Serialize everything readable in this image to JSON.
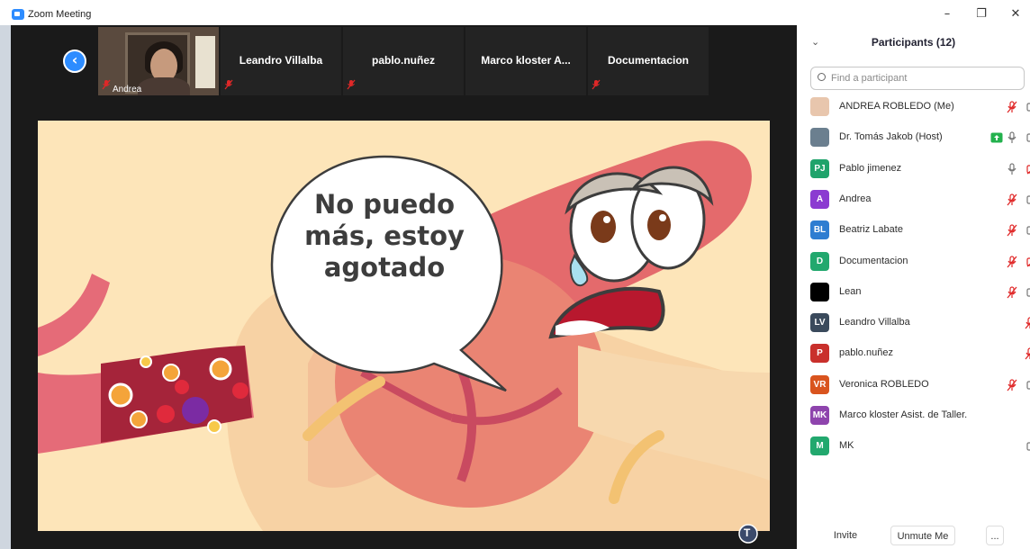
{
  "window": {
    "title": "Zoom Meeting",
    "controls": [
      "–",
      "❐",
      "✕"
    ]
  },
  "video_strip": {
    "self_view_label": "Andrea",
    "tiles": [
      {
        "name": "Leandro Villalba"
      },
      {
        "name": "pablo.nuñez"
      },
      {
        "name": "Marco kloster A..."
      },
      {
        "name": "Documentacion"
      }
    ]
  },
  "shared_screen": {
    "speech_line1": "No puedo",
    "speech_line2": "más, estoy",
    "speech_line3": "agotado",
    "badge": "T"
  },
  "participants_panel": {
    "title": "Participants (12)",
    "search_placeholder": "Find a participant",
    "participants": [
      {
        "initials": "",
        "name": "ANDREA ROBLEDO (Me)",
        "avatar_color": "#e8c6ad",
        "photo": true,
        "mic": "muted",
        "video": "on"
      },
      {
        "initials": "",
        "name": "Dr. Tomás Jakob (Host)",
        "avatar_color": "#6b7f8f",
        "photo": true,
        "mic": "on",
        "video": "on",
        "screen_share": true
      },
      {
        "initials": "PJ",
        "name": "Pablo jimenez",
        "avatar_color": "#20a36b",
        "mic": "on",
        "video": "off"
      },
      {
        "initials": "A",
        "name": "Andrea",
        "avatar_color": "#8b3bd1",
        "mic": "muted",
        "video": "on"
      },
      {
        "initials": "BL",
        "name": "Beatriz Labate",
        "avatar_color": "#2e7dd1",
        "mic": "muted",
        "video": "on"
      },
      {
        "initials": "D",
        "name": "Documentacion",
        "avatar_color": "#22a86e",
        "mic": "muted",
        "video": "off"
      },
      {
        "initials": "",
        "name": "Lean",
        "avatar_color": "#000000",
        "mic": "muted",
        "video": "on"
      },
      {
        "initials": "LV",
        "name": "Leandro Villalba",
        "avatar_color": "#3a4a5c",
        "mic": "muted",
        "video": "none"
      },
      {
        "initials": "P",
        "name": "pablo.nuñez",
        "avatar_color": "#c9302c",
        "mic": "muted",
        "video": "none"
      },
      {
        "initials": "VR",
        "name": "Veronica ROBLEDO",
        "avatar_color": "#d9541e",
        "mic": "muted",
        "video": "on"
      },
      {
        "initials": "MK",
        "name": "Marco kloster Asist. de Taller.",
        "avatar_color": "#8e44ad",
        "mic": "none",
        "video": "none"
      },
      {
        "initials": "M",
        "name": "MK",
        "avatar_color": "#22a86e",
        "mic": "none",
        "video": "on"
      }
    ],
    "footer": {
      "invite": "Invite",
      "unmute": "Unmute Me",
      "more": "..."
    }
  },
  "colors": {
    "accent": "#2d8cff",
    "muted_red": "#e02828",
    "share_green": "#23b14d"
  }
}
